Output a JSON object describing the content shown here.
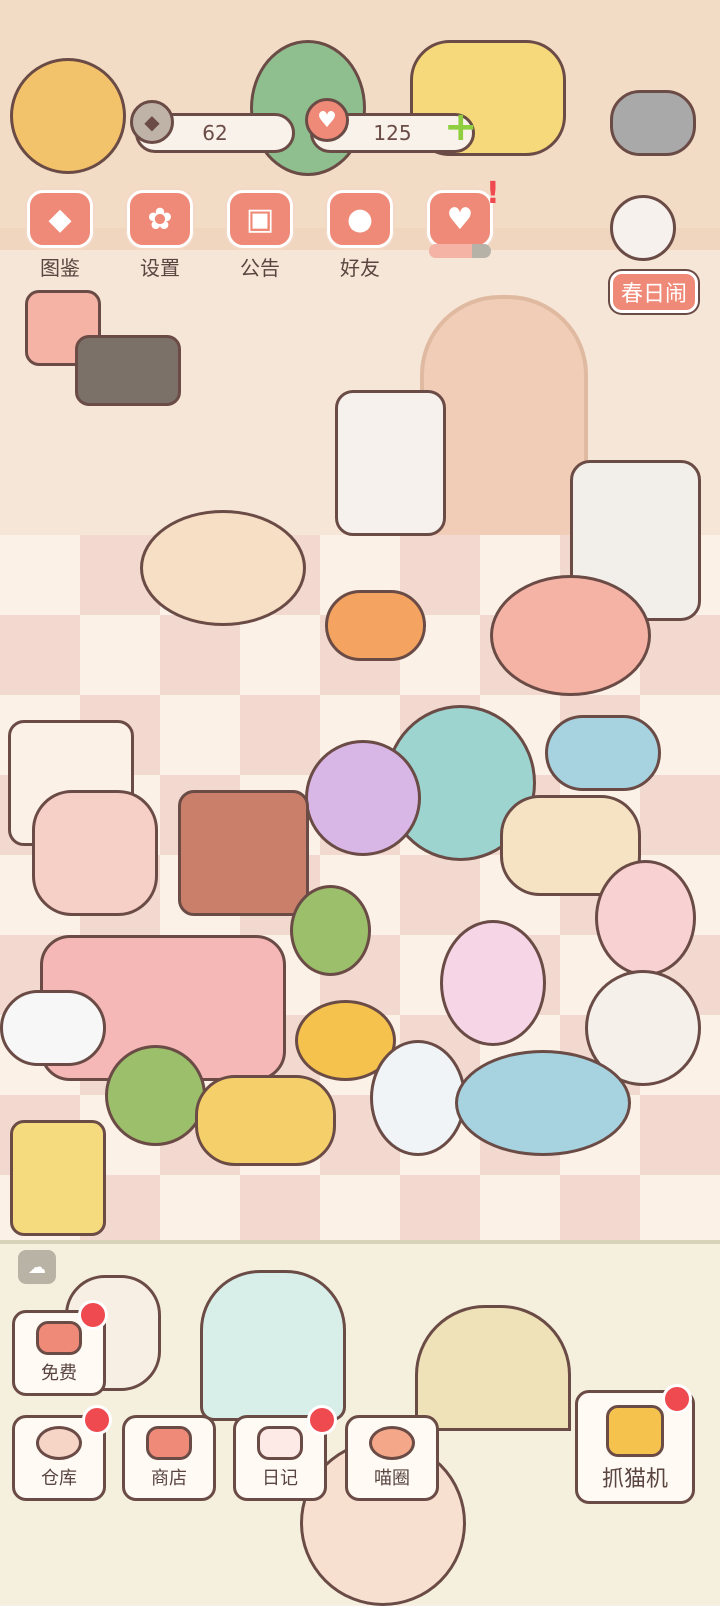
{
  "resources": {
    "fish_count": "62",
    "heart_count": "125"
  },
  "top_menu": [
    {
      "label": "图鉴",
      "icon": "cat-book-icon"
    },
    {
      "label": "设置",
      "icon": "gear-icon"
    },
    {
      "label": "公告",
      "icon": "gift-icon"
    },
    {
      "label": "好友",
      "icon": "friends-icon"
    },
    {
      "label": "",
      "icon": "heart-mail-icon"
    }
  ],
  "event_label": "春日闹",
  "bottom_buttons": {
    "free": "免费",
    "warehouse": "仓库",
    "shop": "商店",
    "diary": "日记",
    "cat_circle": "喵圈",
    "claw_machine": "抓猫机"
  },
  "colors": {
    "accent": "#f08a78",
    "badge": "#ef4a50",
    "outline": "#6b4b45",
    "plus": "#8fcf3f"
  }
}
